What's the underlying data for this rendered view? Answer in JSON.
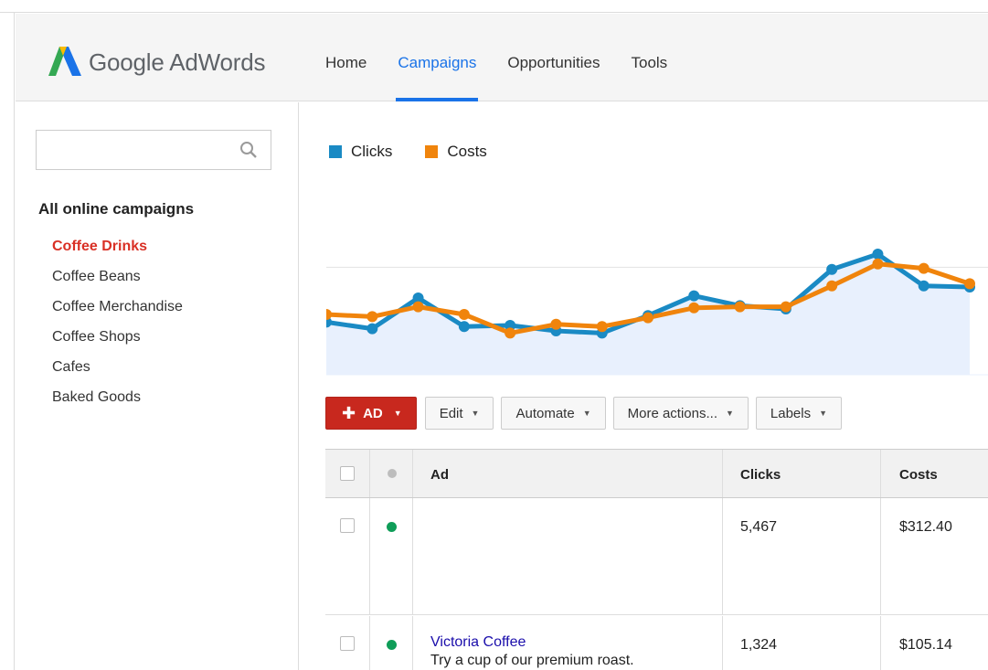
{
  "app": {
    "brand": "Google AdWords"
  },
  "nav": {
    "items": [
      {
        "label": "Home",
        "active": false
      },
      {
        "label": "Campaigns",
        "active": true
      },
      {
        "label": "Opportunities",
        "active": false
      },
      {
        "label": "Tools",
        "active": false
      }
    ]
  },
  "sidebar": {
    "search_placeholder": "",
    "heading": "All online campaigns",
    "campaigns": [
      {
        "label": "Coffee Drinks",
        "active": true
      },
      {
        "label": "Coffee Beans",
        "active": false
      },
      {
        "label": "Coffee Merchandise",
        "active": false
      },
      {
        "label": "Coffee Shops",
        "active": false
      },
      {
        "label": "Cafes",
        "active": false
      },
      {
        "label": "Baked Goods",
        "active": false
      }
    ]
  },
  "colors": {
    "clicks": "#1a8ac4",
    "costs": "#f0840c",
    "accent_blue": "#1a73e8",
    "active_red": "#d93025",
    "ad_button": "#c8281e",
    "status_green": "#0f9d58"
  },
  "chart_data": {
    "type": "line",
    "legend": [
      "Clicks",
      "Costs"
    ],
    "series": [
      {
        "name": "Clicks",
        "values": [
          48,
          42,
          70,
          44,
          45,
          40,
          38,
          54,
          72,
          63,
          60,
          96,
          110,
          81,
          80
        ]
      },
      {
        "name": "Costs",
        "values": [
          55,
          53,
          62,
          55,
          38,
          46,
          44,
          52,
          61,
          62,
          62,
          81,
          101,
          97,
          83
        ]
      }
    ],
    "points_x": [
      0,
      1,
      2,
      3,
      4,
      5,
      6,
      7,
      8,
      9,
      10,
      11,
      12,
      13,
      14
    ],
    "ylim": [
      0,
      140
    ],
    "grid": true
  },
  "toolbar": {
    "ad_label": "AD",
    "edit_label": "Edit",
    "automate_label": "Automate",
    "more_label": "More actions...",
    "labels_label": "Labels"
  },
  "table": {
    "headers": {
      "ad": "Ad",
      "clicks": "Clicks",
      "costs": "Costs"
    },
    "rows": [
      {
        "ad_title": "",
        "ad_desc": "",
        "clicks": "5,467",
        "costs": "$312.40"
      },
      {
        "ad_title": "Victoria Coffee",
        "ad_desc": "Try a cup of our premium roast.",
        "clicks": "1,324",
        "costs": "$105.14"
      }
    ]
  }
}
